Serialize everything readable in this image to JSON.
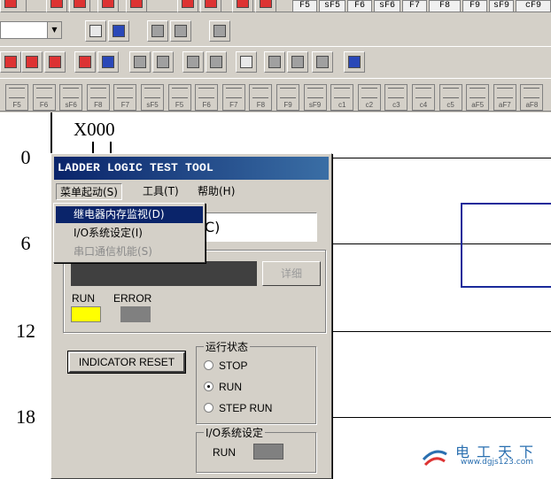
{
  "function_keys": [
    "F5",
    "sF5",
    "F6",
    "sF6",
    "F7",
    "F8",
    "F9",
    "sF9",
    "cF9"
  ],
  "ladder_button_labels": [
    "F5",
    "F6",
    "sF6",
    "F8",
    "F7",
    "sF5",
    "F5",
    "F6",
    "F7",
    "F8",
    "F9",
    "sF9",
    "c1",
    "c2",
    "c3",
    "c4",
    "c5",
    "aF5",
    "aF7",
    "aF8"
  ],
  "ladder": {
    "device": "X000",
    "steps": [
      "0",
      "6",
      "12",
      "18"
    ]
  },
  "dialog": {
    "title": "LADDER LOGIC TEST TOOL",
    "menu": [
      {
        "label": "菜单起动(S)"
      },
      {
        "label": "工具(T)"
      },
      {
        "label": "帮助(H)"
      }
    ],
    "textbox_value": "C)",
    "detail_button": "详细",
    "indicators": {
      "run_label": "RUN",
      "error_label": "ERROR",
      "run_color": "#ffff00",
      "error_color": "#808080"
    },
    "reset_button": "INDICATOR RESET",
    "run_state": {
      "legend": "运行状态",
      "options": [
        "STOP",
        "RUN",
        "STEP RUN"
      ],
      "selected": "RUN"
    },
    "io_settings": {
      "legend": "I/O系统设定",
      "run_label": "RUN"
    }
  },
  "dropdown": {
    "items": [
      {
        "label": "继电器内存监视(D)",
        "state": "highlighted"
      },
      {
        "label": "I/O系统设定(I)",
        "state": "normal"
      },
      {
        "label": "串口通信机能(S)",
        "state": "disabled"
      }
    ]
  },
  "watermark": {
    "title": "电工天下",
    "url": "www.dgjs123.com"
  },
  "colors": {
    "titlebar": "#0a246a",
    "accent_blue": "#1a2a9a"
  }
}
